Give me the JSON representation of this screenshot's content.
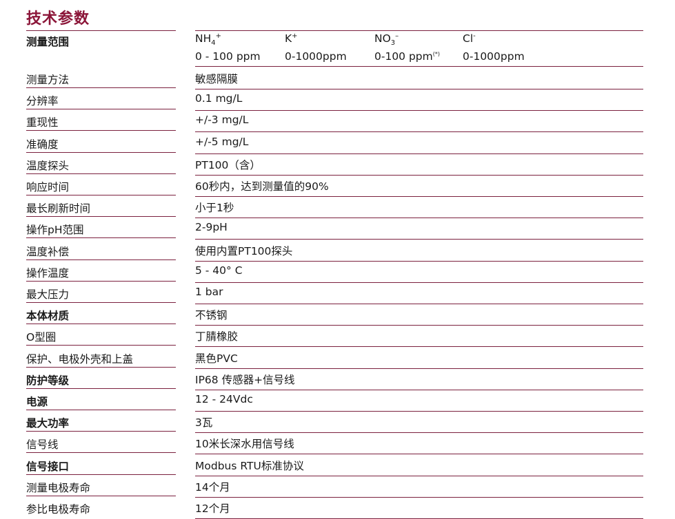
{
  "title": "技术参数",
  "range": {
    "label": "测量范围",
    "ions": [
      {
        "base": "NH",
        "sub": "4",
        "sup": "+",
        "range": "0 - 100 ppm",
        "note": ""
      },
      {
        "base": "K",
        "sub": "",
        "sup": "+",
        "range": "0-1000ppm",
        "note": ""
      },
      {
        "base": "NO",
        "sub": "3",
        "sup": "–",
        "range": "0-100 ppm",
        "note": "(*)"
      },
      {
        "base": "Cl",
        "sub": "",
        "sup": "-",
        "range": "0-1000ppm",
        "note": ""
      }
    ]
  },
  "rows": [
    {
      "label": "测量方法",
      "value": "敏感隔膜",
      "bold": false
    },
    {
      "label": "分辨率",
      "value": "0.1 mg/L",
      "bold": false
    },
    {
      "label": "重现性",
      "value": "+/-3 mg/L",
      "bold": false
    },
    {
      "label": "准确度",
      "value": "+/-5 mg/L",
      "bold": false
    },
    {
      "label": "温度探头",
      "value": "PT100（含）",
      "bold": false
    },
    {
      "label": "响应时间",
      "value": "60秒内，达到测量值的90%",
      "bold": false
    },
    {
      "label": "最长刷新时间",
      "value": "小于1秒",
      "bold": false
    },
    {
      "label": "操作pH范围",
      "value": "2-9pH",
      "bold": false
    },
    {
      "label": "温度补偿",
      "value": "使用内置PT100探头",
      "bold": false
    },
    {
      "label": "操作温度",
      "value": "5 - 40°  C",
      "bold": false
    },
    {
      "label": "最大压力",
      "value": "1 bar",
      "bold": false
    },
    {
      "label": "本体材质",
      "value": "不锈钢",
      "bold": true
    },
    {
      "label": "O型圈",
      "value": "丁腈橡胶",
      "bold": false
    },
    {
      "label": "保护、电极外壳和上盖",
      "value": "黑色PVC",
      "bold": false
    },
    {
      "label": "防护等级",
      "value": "IP68 传感器+信号线",
      "bold": true
    },
    {
      "label": "电源",
      "value": "12 - 24Vdc",
      "bold": true
    },
    {
      "label": "最大功率",
      "value": "3瓦",
      "bold": true
    },
    {
      "label": "信号线",
      "value": "10米长深水用信号线",
      "bold": false
    },
    {
      "label": "信号接口",
      "value": "Modbus RTU标准协议",
      "bold": true
    },
    {
      "label": "测量电极寿命",
      "value": "14个月",
      "bold": false
    },
    {
      "label": "参比电极寿命",
      "value": "12个月",
      "bold": false
    }
  ]
}
